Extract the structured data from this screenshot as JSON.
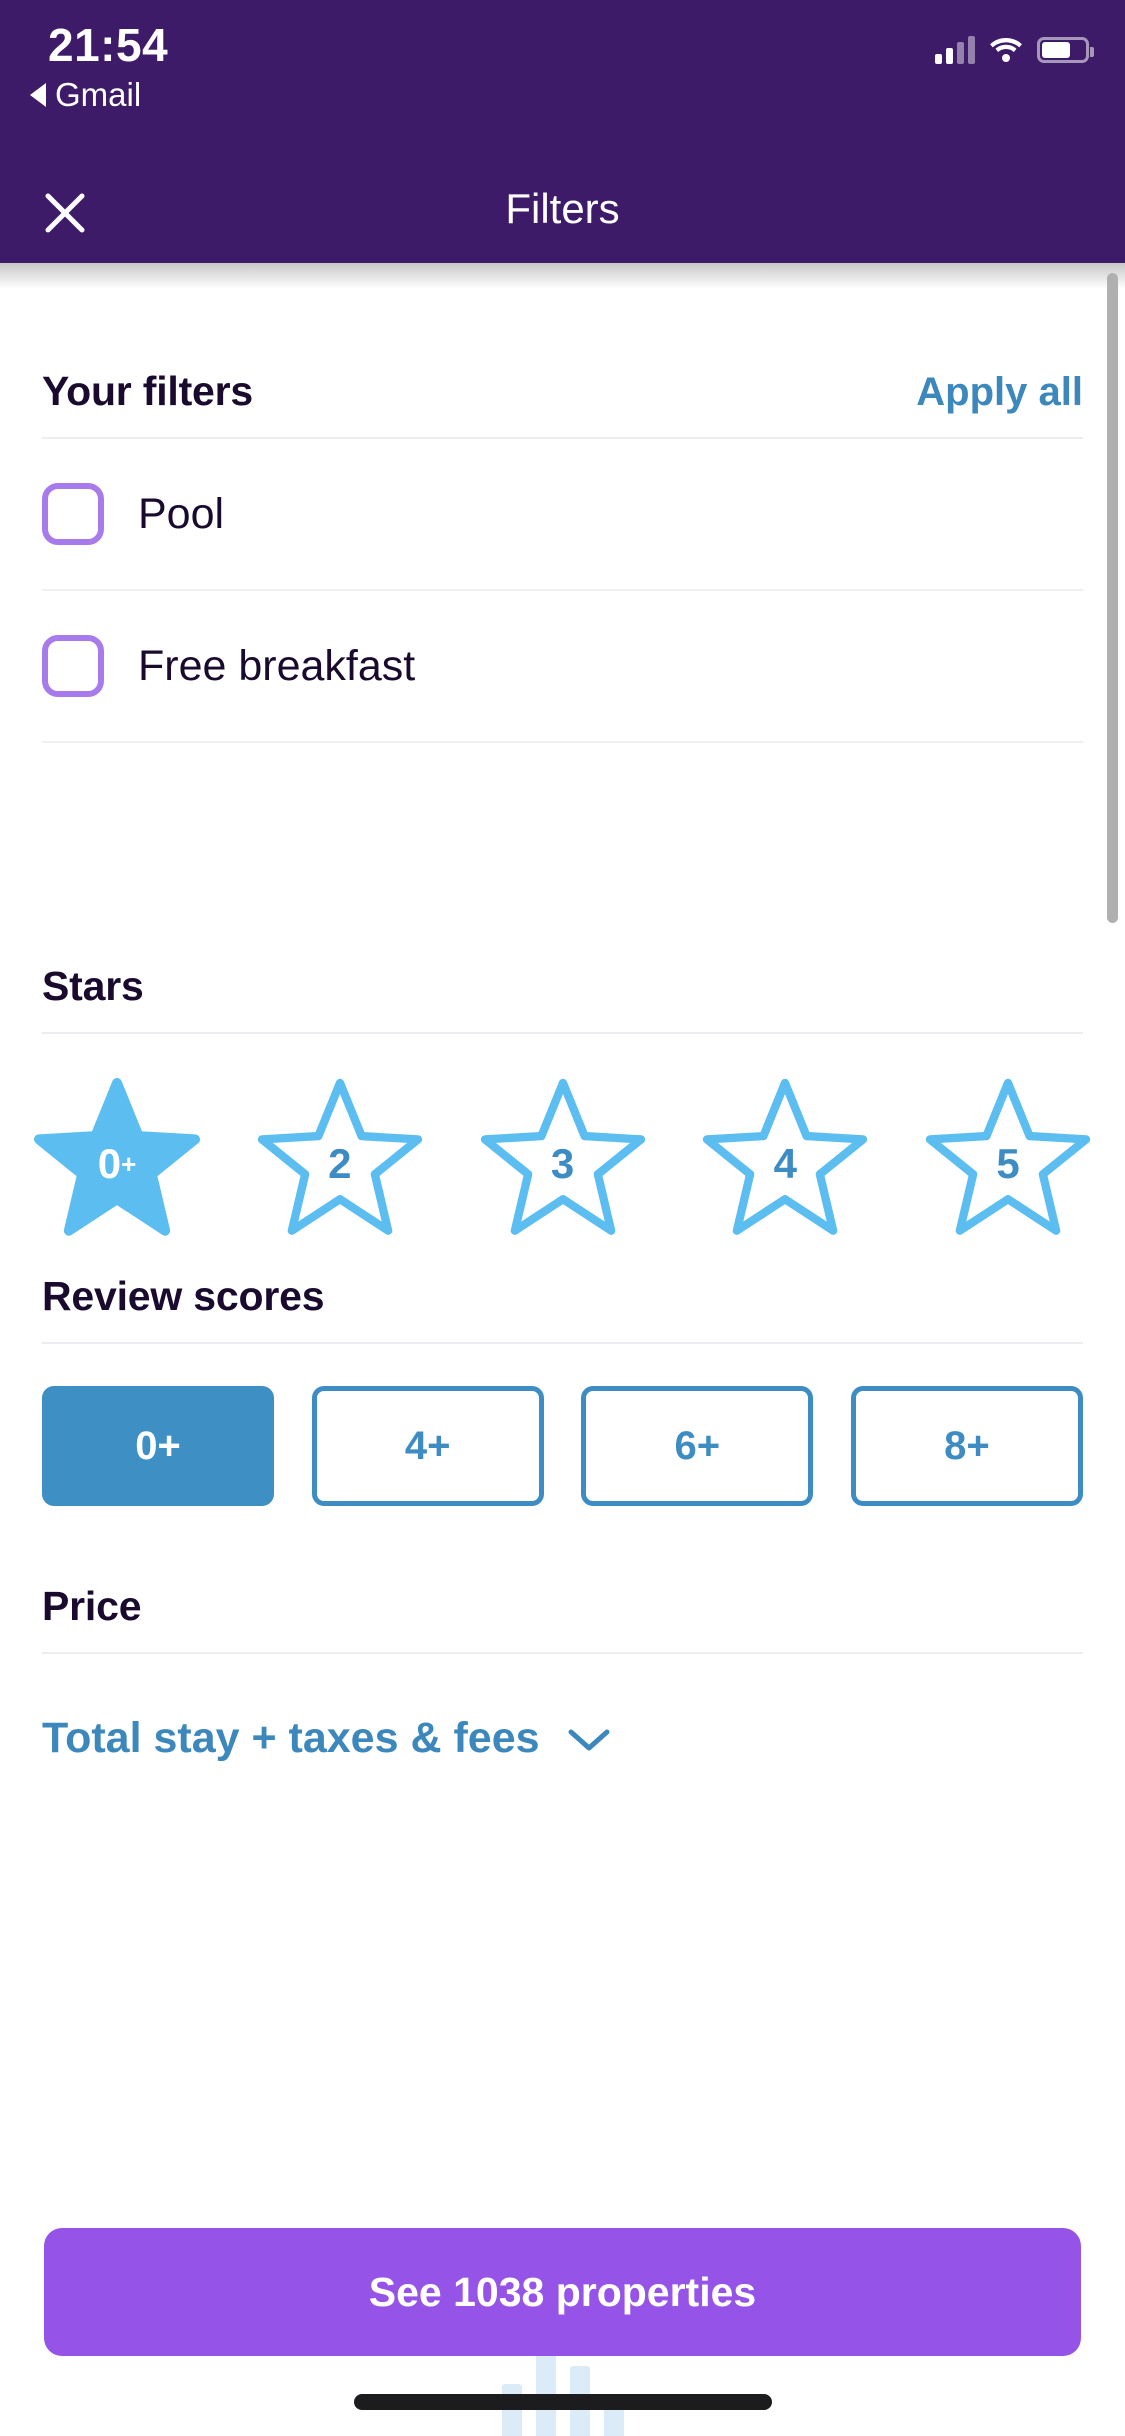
{
  "status_bar": {
    "time": "21:54",
    "back_app_label": "Gmail",
    "back_icon": "triangle-left-icon",
    "signal_icon": "cellular-signal-icon",
    "wifi_icon": "wifi-icon",
    "battery_icon": "battery-icon"
  },
  "header": {
    "title": "Filters",
    "close_icon": "close-icon",
    "background_color": "#3D1B68"
  },
  "your_filters": {
    "title": "Your filters",
    "apply_all_label": "Apply all",
    "items": [
      {
        "label": "Pool",
        "checked": false
      },
      {
        "label": "Free breakfast",
        "checked": false
      }
    ]
  },
  "stars": {
    "title": "Stars",
    "options": [
      {
        "label": "0",
        "suffix": "+",
        "selected": true
      },
      {
        "label": "2",
        "suffix": "",
        "selected": false
      },
      {
        "label": "3",
        "suffix": "",
        "selected": false
      },
      {
        "label": "4",
        "suffix": "",
        "selected": false
      },
      {
        "label": "5",
        "suffix": "",
        "selected": false
      }
    ]
  },
  "review_scores": {
    "title": "Review scores",
    "options": [
      {
        "label": "0+",
        "selected": true
      },
      {
        "label": "4+",
        "selected": false
      },
      {
        "label": "6+",
        "selected": false
      },
      {
        "label": "8+",
        "selected": false
      }
    ]
  },
  "price": {
    "title": "Price",
    "toggle_label": "Total stay + taxes & fees",
    "chevron_icon": "chevron-down-icon"
  },
  "footer": {
    "cta_label": "See 1038 properties",
    "cta_color": "#9553E8",
    "home_indicator": "home-indicator"
  },
  "colors": {
    "header_purple": "#3D1B68",
    "checkbox_purple": "#A77BEB",
    "link_blue": "#3C87BC",
    "star_blue": "#5BBDF0",
    "pill_blue": "#3E8FC4",
    "cta_purple": "#9553E8"
  }
}
